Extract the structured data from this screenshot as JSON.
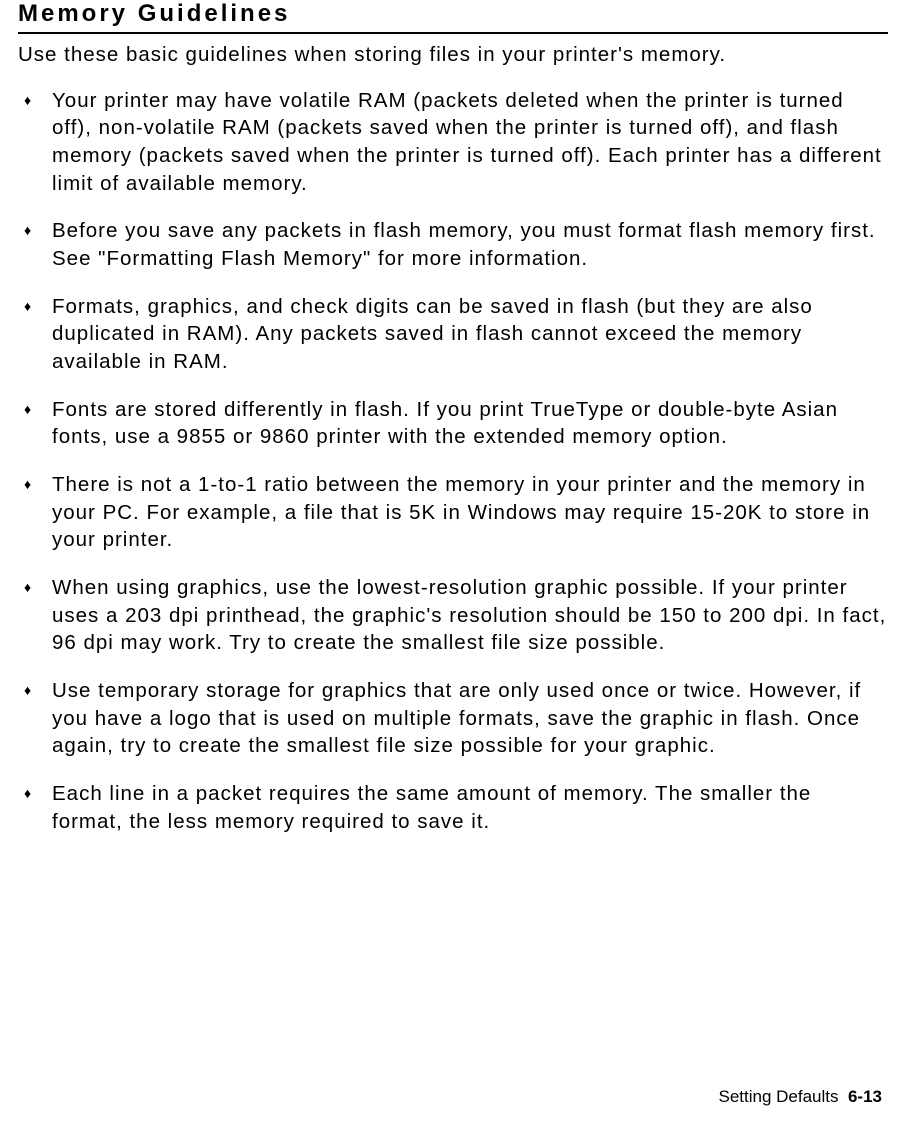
{
  "heading": "Memory Guidelines",
  "intro": "Use these basic guidelines when storing files in your printer's memory.",
  "bullets": [
    "Your printer may have volatile RAM (packets deleted when the printer is turned off), non-volatile RAM (packets saved when the printer is turned off), and flash memory (packets saved when the printer is turned off).  Each printer has a different limit of available memory.",
    "Before you save any packets in flash memory, you must format flash memory first.  See \"Formatting Flash Memory\" for more information.",
    "Formats, graphics, and check digits can be saved in flash (but they are also duplicated in RAM).  Any packets saved in flash cannot exceed the memory available in RAM.",
    "Fonts are stored differently in flash.  If you print TrueType or double-byte Asian fonts, use a 9855 or 9860 printer with the extended memory option.",
    "There is not a 1-to-1 ratio between the memory in your printer and the memory in your PC.  For example, a file that is 5K in Windows may require 15-20K to store in your printer.",
    "When using graphics, use the lowest-resolution graphic possible.  If your printer uses a 203 dpi printhead, the graphic's resolution should be 150 to 200 dpi.  In fact, 96 dpi may work.  Try to create the smallest file size possible.",
    "Use temporary storage for graphics that are only used once or twice.  However, if you have a logo that is used on multiple formats, save the graphic in flash.  Once again, try to create the smallest file size possible for your graphic.",
    "Each line in a packet requires the same amount of memory.  The smaller the format, the less memory required to save it."
  ],
  "footer": {
    "section": "Setting Defaults",
    "page": "6-13"
  }
}
